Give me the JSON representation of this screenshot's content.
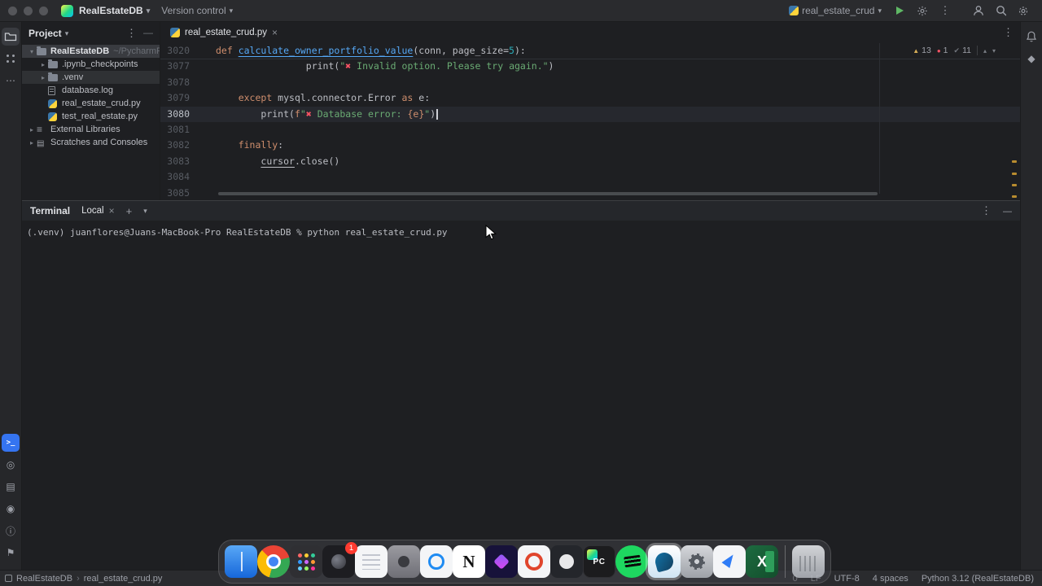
{
  "colors": {
    "accent": "#3574f0",
    "run_green": "#5fb865",
    "error_red": "#f75464",
    "warning_yellow": "#d6ae58"
  },
  "titlebar": {
    "project": "RealEstateDB",
    "version_control": "Version control",
    "run_config": "real_estate_crud"
  },
  "project_panel": {
    "title": "Project",
    "tree": [
      {
        "label": "RealEstateDB",
        "suffix": "~/PycharmProjec",
        "icon": "folder",
        "chevron": "down",
        "indent": 0,
        "selected": true,
        "bold": true
      },
      {
        "label": ".ipynb_checkpoints",
        "icon": "folder",
        "chevron": "right",
        "indent": 1
      },
      {
        "label": ".venv",
        "icon": "folder",
        "chevron": "right",
        "indent": 1,
        "hover": true
      },
      {
        "label": "database.log",
        "icon": "file",
        "indent": 1
      },
      {
        "label": "real_estate_crud.py",
        "icon": "python",
        "indent": 1
      },
      {
        "label": "test_real_estate.py",
        "icon": "python",
        "indent": 1
      },
      {
        "label": "External Libraries",
        "icon": "lib",
        "chevron": "right",
        "indent": 0
      },
      {
        "label": "Scratches and Consoles",
        "icon": "console",
        "chevron": "right",
        "indent": 0
      }
    ]
  },
  "editor": {
    "tab": "real_estate_crud.py",
    "inspections": {
      "warnings": "13",
      "errors": "1",
      "passed": "11"
    },
    "sticky_line": {
      "num": "3020",
      "tokens": [
        {
          "t": "def ",
          "c": "kw"
        },
        {
          "t": "calculate_owner_portfolio_value",
          "c": "fn"
        },
        {
          "t": "(conn, page_size=",
          "c": "d"
        },
        {
          "t": "5",
          "c": "num"
        },
        {
          "t": "):",
          "c": "d"
        }
      ]
    },
    "lines": [
      {
        "num": "3077",
        "tokens": [
          {
            "t": "                ",
            "c": "d"
          },
          {
            "t": "print",
            "c": "d"
          },
          {
            "t": "(",
            "c": "d"
          },
          {
            "t": "\"",
            "c": "str"
          },
          {
            "t": "✖",
            "c": "x"
          },
          {
            "t": " Invalid option. Please try again.\"",
            "c": "str"
          },
          {
            "t": ")",
            "c": "d"
          }
        ]
      },
      {
        "num": "3078",
        "tokens": []
      },
      {
        "num": "3079",
        "tokens": [
          {
            "t": "    ",
            "c": "d"
          },
          {
            "t": "except ",
            "c": "kw"
          },
          {
            "t": "mysql.connector.Error ",
            "c": "d"
          },
          {
            "t": "as ",
            "c": "kw"
          },
          {
            "t": "e:",
            "c": "d"
          }
        ]
      },
      {
        "num": "3080",
        "current": true,
        "tokens": [
          {
            "t": "        ",
            "c": "d"
          },
          {
            "t": "print",
            "c": "d"
          },
          {
            "t": "(",
            "c": "d"
          },
          {
            "t": "f",
            "c": "kw"
          },
          {
            "t": "\"",
            "c": "str"
          },
          {
            "t": "✖",
            "c": "x"
          },
          {
            "t": " Database error: ",
            "c": "str"
          },
          {
            "t": "{e}",
            "c": "kw"
          },
          {
            "t": "\"",
            "c": "str"
          },
          {
            "t": ")",
            "c": "d"
          }
        ]
      },
      {
        "num": "3081",
        "tokens": []
      },
      {
        "num": "3082",
        "tokens": [
          {
            "t": "    ",
            "c": "d"
          },
          {
            "t": "finally",
            "c": "kw"
          },
          {
            "t": ":",
            "c": "d"
          }
        ]
      },
      {
        "num": "3083",
        "tokens": [
          {
            "t": "        ",
            "c": "d"
          },
          {
            "t": "cursor",
            "c": "du"
          },
          {
            "t": ".close()",
            "c": "d"
          }
        ]
      },
      {
        "num": "3084",
        "tokens": []
      },
      {
        "num": "3085",
        "tokens": []
      }
    ]
  },
  "terminal": {
    "title": "Terminal",
    "tab": "Local",
    "prompt": "(.venv) juanflores@Juans-MacBook-Pro RealEstateDB % python real_estate_crud.py"
  },
  "statusbar": {
    "breadcrumb": [
      "RealEstateDB",
      "real_estate_crud.py"
    ],
    "items": [
      "0",
      "LF",
      "UTF-8",
      "4 spaces",
      "Python 3.12 (RealEstateDB)"
    ]
  },
  "dock": {
    "icons": [
      {
        "name": "finder",
        "style": "finder"
      },
      {
        "name": "chrome",
        "style": "chrome"
      },
      {
        "name": "launchpad",
        "style": "launchpad"
      },
      {
        "name": "screenshot-tool",
        "style": "dark-cam",
        "badge": "1"
      },
      {
        "name": "textedit",
        "style": "white-doc"
      },
      {
        "name": "camera-app",
        "style": "gray"
      },
      {
        "name": "app-store",
        "style": "white-blue"
      },
      {
        "name": "notion",
        "style": "white",
        "letter": "N"
      },
      {
        "name": "arc-browser",
        "style": "purple"
      },
      {
        "name": "red-ring-app",
        "style": "ring"
      },
      {
        "name": "github-desktop",
        "style": "dark-octo"
      },
      {
        "name": "pycharm",
        "style": "pycharm",
        "letter": "PC"
      },
      {
        "name": "spotify",
        "style": "spotify"
      },
      {
        "name": "mysql-workbench",
        "style": "mysql",
        "active": true
      },
      {
        "name": "system-settings",
        "style": "gear"
      },
      {
        "name": "cursor-app",
        "style": "cursor"
      },
      {
        "name": "excel",
        "style": "excel",
        "letter": "X"
      },
      {
        "name": "trash",
        "style": "trash",
        "separated": true
      }
    ]
  }
}
